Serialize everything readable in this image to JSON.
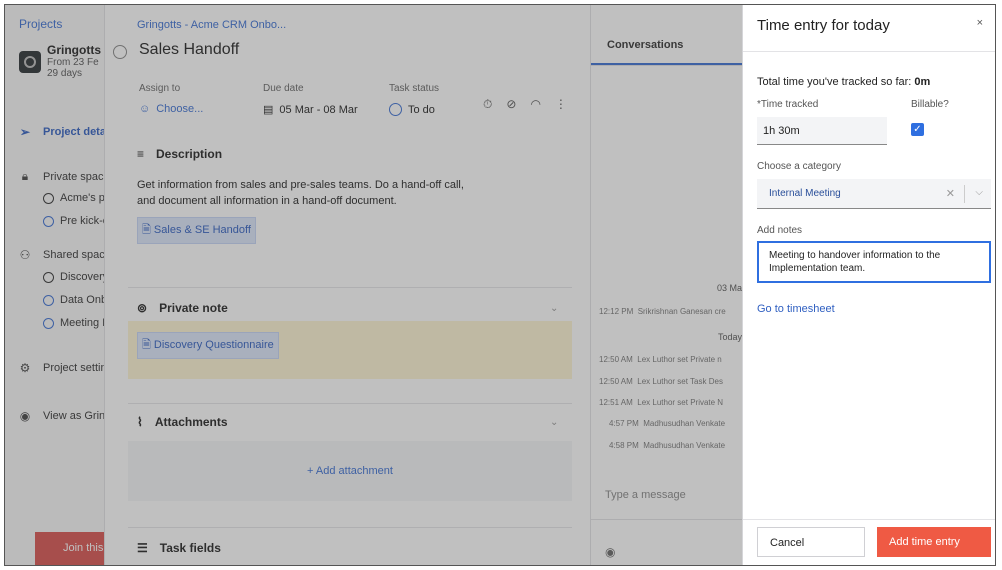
{
  "sidebar": {
    "projects_link": "Projects",
    "project_name": "Gringotts",
    "project_from": "From 23 Fe",
    "project_days": "29 days",
    "items": [
      {
        "label": "Project detai",
        "icon": "send-icon"
      },
      {
        "label": "Private space",
        "icon": "lock-icon"
      },
      {
        "label": "Acme's pl",
        "icon": "circle-icon"
      },
      {
        "label": "Pre kick-c",
        "icon": "circle-icon"
      },
      {
        "label": "Shared space",
        "icon": "people-icon"
      },
      {
        "label": "Discovery",
        "icon": "circle-icon"
      },
      {
        "label": "Data Onb",
        "icon": "circle-icon"
      },
      {
        "label": "Meeting N",
        "icon": "circle-icon"
      },
      {
        "label": "Project settin",
        "icon": "gear-icon"
      },
      {
        "label": "View as Gring",
        "icon": "eye-icon"
      }
    ],
    "join_button": "Join this pro"
  },
  "task": {
    "breadcrumb": "Gringotts - Acme CRM Onbo...",
    "title": "Sales Handoff",
    "assign_label": "Assign to",
    "assign_value": "Choose...",
    "due_label": "Due date",
    "due_value": "05 Mar - 08 Mar",
    "status_label": "Task status",
    "status_value": "To do",
    "description_heading": "Description",
    "description_text": "Get information from sales and pre-sales teams. Do a hand-off call, and document all information in a hand-off document.",
    "description_tag": "Sales & SE Handoff",
    "private_note_heading": "Private note",
    "private_note_tag": "Discovery Questionnaire",
    "attachments_heading": "Attachments",
    "add_attachment": "+ Add attachment",
    "task_fields_heading": "Task fields"
  },
  "conversations": {
    "heading": "Conversations",
    "date1": "03 Ma",
    "msg1_time": "12:12 PM",
    "msg1_text": "Srikrishnan Ganesan cre",
    "date2": "Today",
    "messages": [
      {
        "time": "12:50 AM",
        "text": "Lex Luthor set Private n"
      },
      {
        "time": "12:50 AM",
        "text": "Lex Luthor set Task Des"
      },
      {
        "time": "12:51 AM",
        "text": "Lex Luthor set Private N"
      },
      {
        "time": "4:57 PM",
        "text": "Madhusudhan Venkate"
      },
      {
        "time": "4:58 PM",
        "text": "Madhusudhan Venkate"
      }
    ],
    "type_placeholder": "Type a message"
  },
  "panel": {
    "title": "Time entry for today",
    "close": "×",
    "total_label": "Total time you've tracked so far:",
    "total_value": "0m",
    "time_label": "*Time tracked",
    "time_value": "1h 30m",
    "billable_label": "Billable?",
    "billable_checked": true,
    "category_label": "Choose a category",
    "category_value": "Internal Meeting",
    "notes_label": "Add notes",
    "notes_value": "Meeting to handover information to the Implementation team.",
    "timesheet_link": "Go to timesheet",
    "cancel_button": "Cancel",
    "add_button": "Add time entry"
  }
}
